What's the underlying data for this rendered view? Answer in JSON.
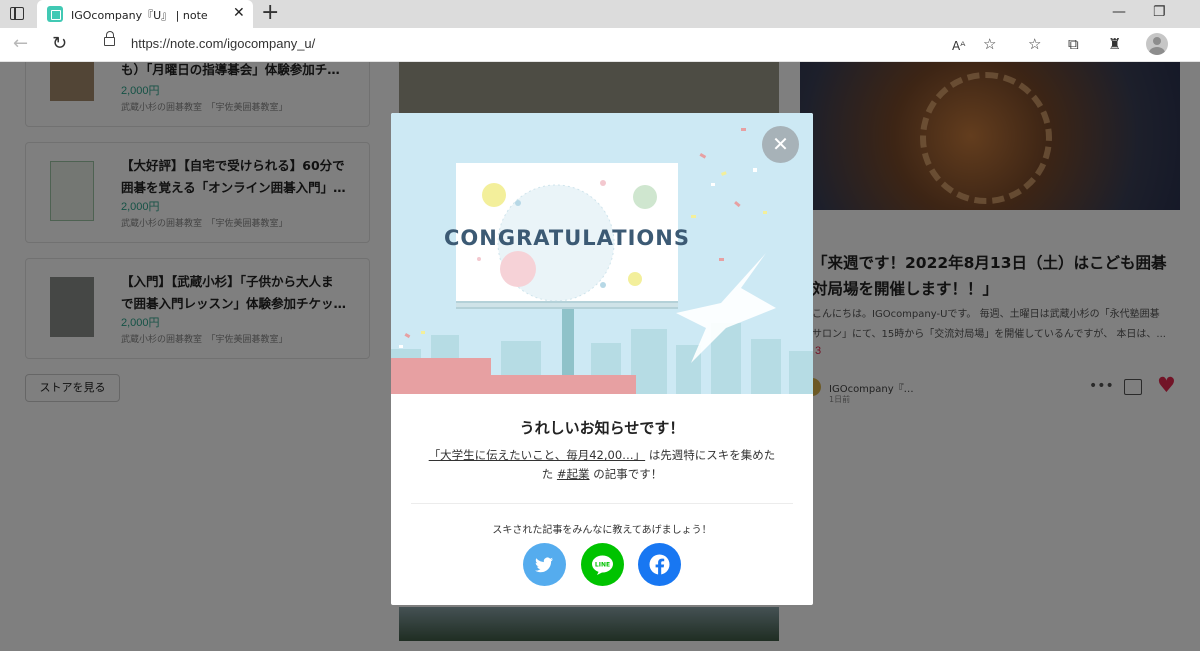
{
  "browser": {
    "tab_title": "IGOcompany『U』 | note",
    "url": "https://note.com/igocompany_u/",
    "read_aloud_label": "Aᴬ"
  },
  "store": {
    "items": [
      {
        "title_line1": "も）「月曜日の指導碁会」体験参加チ…",
        "title_line2": "",
        "price": "2,000円",
        "shop": "武蔵小杉の囲碁教室　「宇佐美囲碁教室」"
      },
      {
        "title_line1": "【大好評】【自宅で受けられる】60分で",
        "title_line2": "囲碁を覚える「オンライン囲碁入門」…",
        "price": "2,000円",
        "shop": "武蔵小杉の囲碁教室　「宇佐美囲碁教室」"
      },
      {
        "title_line1": "【入門】【武蔵小杉】「子供から大人ま",
        "title_line2": "で囲碁入門レッスン」体験参加チケッ…",
        "price": "2,000円",
        "shop": "武蔵小杉の囲碁教室　「宇佐美囲碁教室」"
      }
    ],
    "button_label": "ストアを見る"
  },
  "article": {
    "title_line1": "「来週です！2022年8月13日（土）はこども囲碁",
    "title_line2": "対局場を開催します！！」",
    "excerpt_line1": "こんにちは。IGOcompany-Uです。 毎週、土曜日は武蔵小杉の「永代塾囲碁",
    "excerpt_line2": "サロン」にて、15時から「交流対局場」を開催しているんですが、 本日は、...",
    "likes": "3",
    "author": "IGOcompany『…",
    "date": "1日前"
  },
  "modal": {
    "banner_text": "CONGRATULATIONS",
    "heading": "うれしいお知らせです！",
    "message_open": "「",
    "article_link": "「大学生に伝えたいこと、毎月42,00…」",
    "message_mid": "は先週特にスキを集めた",
    "hashtag": "#起業",
    "message_end": "の記事です！",
    "share_prompt": "スキされた記事をみんなに教えてあげましょう！",
    "line_label": "LINE",
    "share_buttons": [
      "twitter",
      "line",
      "facebook"
    ]
  },
  "colors": {
    "overlay": "rgba(0,0,0,0.5)",
    "twitter": "#55acee",
    "line": "#00c300",
    "facebook": "#1877f2",
    "price": "#2ca58d",
    "heart": "#e5284f"
  }
}
